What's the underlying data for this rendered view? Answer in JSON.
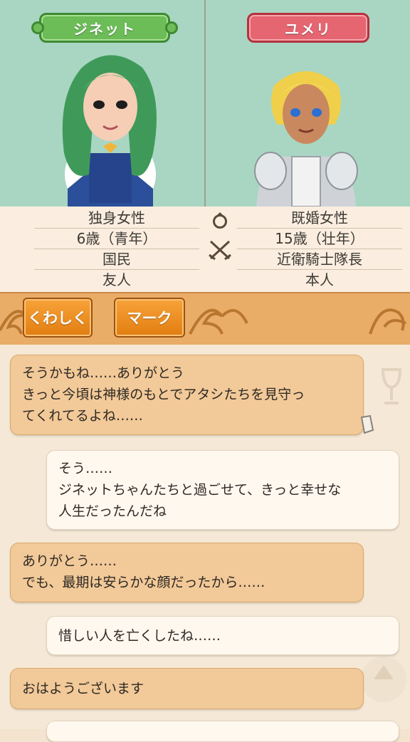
{
  "characters": {
    "left": {
      "name": "ジネット",
      "tag_color": "#6cbc58",
      "info": [
        "独身女性",
        "6歳（青年）",
        "国民",
        "友人"
      ]
    },
    "right": {
      "name": "ユメリ",
      "tag_color": "#e56571",
      "info": [
        "既婚女性",
        "15歳（壮年）",
        "近衛騎士隊長",
        "本人"
      ]
    }
  },
  "relation_icons": [
    "ring-icon",
    "crossed-swords-icon"
  ],
  "buttons": {
    "detail": "くわしく",
    "mark": "マーク"
  },
  "messages": [
    {
      "side": "left",
      "text": "そうかもね……ありがとう\nきっと今頃は神様のもとでアタシたちを見守っ\nてくれてるよね……"
    },
    {
      "side": "right",
      "text": "そう……\nジネットちゃんたちと過ごせて、きっと幸せな\n人生だったんだね"
    },
    {
      "side": "left",
      "text": "ありがとう……\nでも、最期は安らかな顔だったから……"
    },
    {
      "side": "right",
      "text": "惜しい人を亡くしたね……"
    },
    {
      "side": "left",
      "text": "おはようございます"
    }
  ],
  "colors": {
    "portrait_bg": "#a9d6c3",
    "strip": "#e9ad68",
    "button": "#f19126"
  }
}
